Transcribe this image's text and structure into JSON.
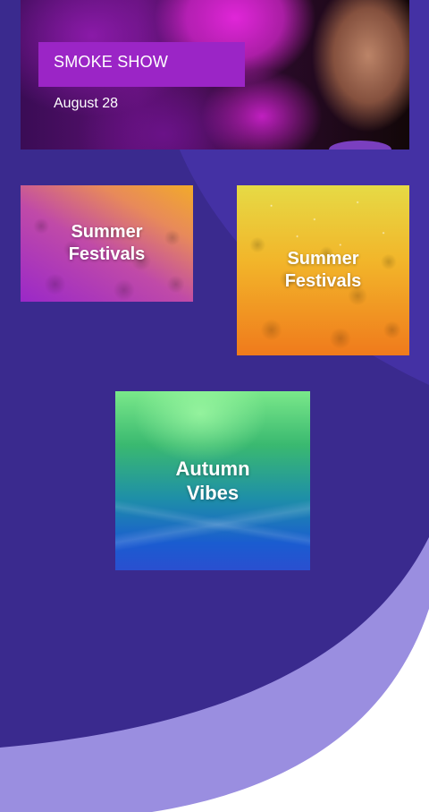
{
  "hero": {
    "title": "SMOKE SHOW",
    "date": "August 28"
  },
  "tiles": [
    {
      "line1": "Summer",
      "line2": "Festivals"
    },
    {
      "line1": "Summer",
      "line2": "Festivals"
    },
    {
      "line1": "Autumn",
      "line2": "Vibes"
    }
  ],
  "colors": {
    "background": "#3a2a8e",
    "wave_light": "#9a8ee0",
    "wave_mid": "#4a35a8",
    "label_purple": "#9b25c6"
  }
}
